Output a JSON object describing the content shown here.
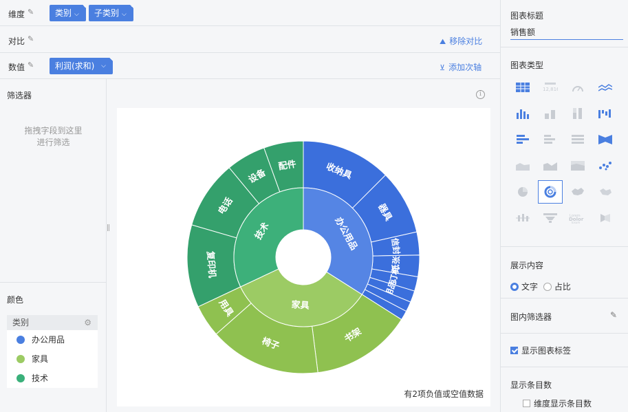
{
  "shelf": {
    "dimension": {
      "label": "维度",
      "chips": [
        "类别",
        "子类别"
      ]
    },
    "compare": {
      "label": "对比",
      "action": "移除对比"
    },
    "value": {
      "label": "数值",
      "chips": [
        "利润(求和)"
      ],
      "action": "添加次轴"
    }
  },
  "filter": {
    "title": "筛选器",
    "hint_line1": "拖拽字段到这里",
    "hint_line2": "进行筛选"
  },
  "color": {
    "title": "颜色",
    "field": "类别",
    "items": [
      {
        "label": "办公用品",
        "color": "#4a7fe0"
      },
      {
        "label": "家具",
        "color": "#9ccb64"
      },
      {
        "label": "技术",
        "color": "#3ab07a"
      }
    ]
  },
  "chart": {
    "footnote": "有2项负值或空值数据"
  },
  "chart_data": {
    "type": "sunburst",
    "inner": [
      {
        "name": "办公用品",
        "color": "#4a7fe0",
        "value": 34.0
      },
      {
        "name": "家具",
        "color": "#9ccb64",
        "value": 34.0
      },
      {
        "name": "技术",
        "color": "#3ab07a",
        "value": 32.0
      }
    ],
    "outer": [
      {
        "parent": "办公用品",
        "name": "收纳具",
        "value": 12.5,
        "color": "#3b6fdc"
      },
      {
        "parent": "办公用品",
        "name": "器具",
        "value": 9.0,
        "color": "#3b6fdc"
      },
      {
        "parent": "办公用品",
        "name": "信封",
        "value": 3.2,
        "color": "#3b6fdc"
      },
      {
        "parent": "办公用品",
        "name": "纸张",
        "value": 3.0,
        "color": "#3b6fdc"
      },
      {
        "parent": "办公用品",
        "name": "装订机",
        "value": 2.0,
        "color": "#3b6fdc"
      },
      {
        "parent": "办公用品",
        "name": "用品",
        "value": 1.6,
        "color": "#3b6fdc"
      },
      {
        "parent": "办公用品",
        "name": "",
        "value": 1.4,
        "color": "#3b6fdc"
      },
      {
        "parent": "办公用品",
        "name": "",
        "value": 1.3,
        "color": "#3b6fdc"
      },
      {
        "parent": "家具",
        "name": "书架",
        "value": 14.0,
        "color": "#8fc150"
      },
      {
        "parent": "家具",
        "name": "椅子",
        "value": 15.5,
        "color": "#8fc150"
      },
      {
        "parent": "家具",
        "name": "用具",
        "value": 4.5,
        "color": "#8fc150"
      },
      {
        "parent": "技术",
        "name": "复印机",
        "value": 11.5,
        "color": "#34a06c"
      },
      {
        "parent": "技术",
        "name": "电话",
        "value": 9.5,
        "color": "#34a06c"
      },
      {
        "parent": "技术",
        "name": "设备",
        "value": 5.5,
        "color": "#34a06c"
      },
      {
        "parent": "技术",
        "name": "配件",
        "value": 5.5,
        "color": "#34a06c"
      }
    ]
  },
  "panel": {
    "title_label": "图表标题",
    "title_value": "销售额",
    "type_label": "图表类型",
    "content_label": "展示内容",
    "content_opt1": "文字",
    "content_opt2": "占比",
    "inner_filter_label": "图内筛选器",
    "show_labels": "显示图表标签",
    "show_count_label": "显示条目数",
    "dim_count_label": "维度显示条目数"
  }
}
